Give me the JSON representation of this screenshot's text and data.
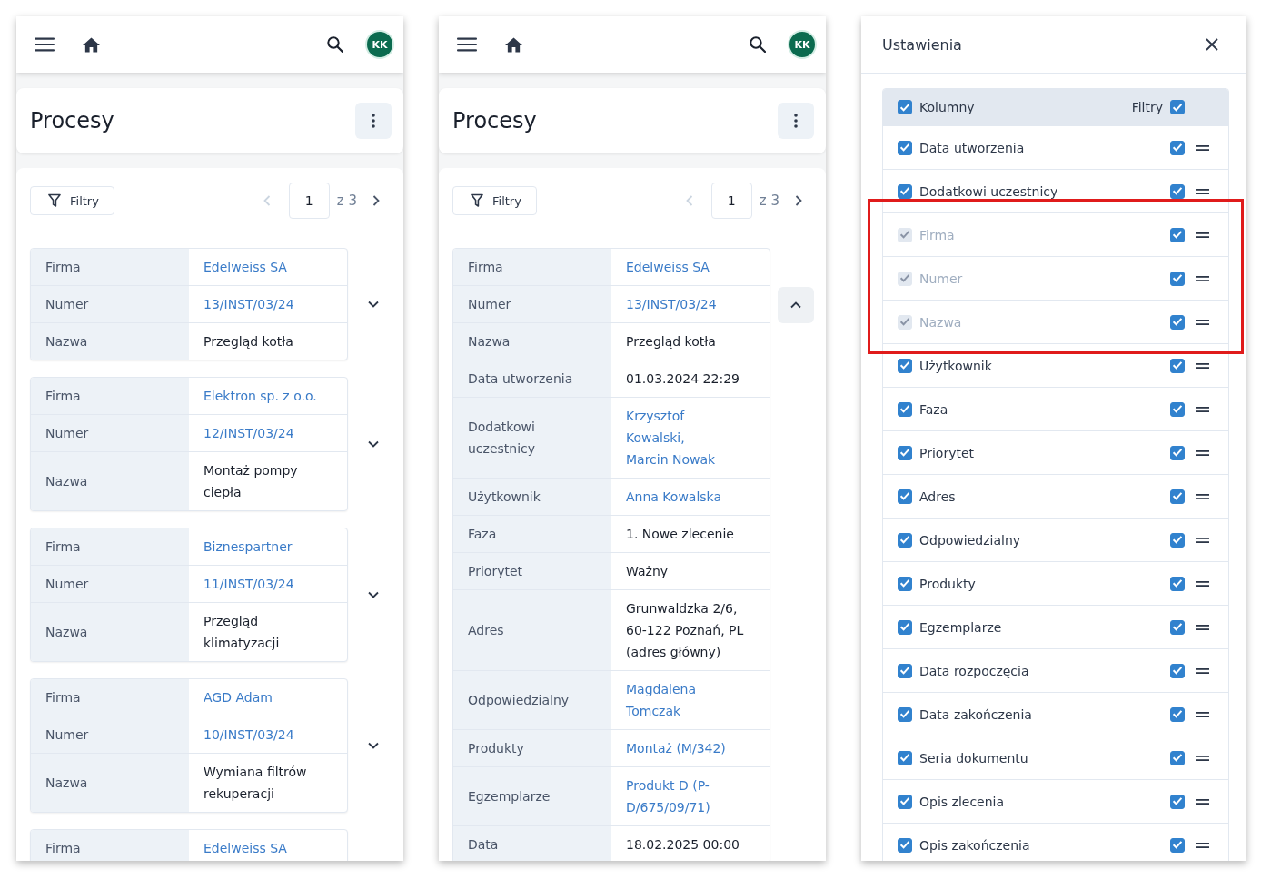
{
  "screens": [
    {
      "kind": "process_list",
      "top_bar": {
        "avatar": "KK"
      },
      "title": "Procesy",
      "toolbar": {
        "filter_button": "Filtry",
        "page": "1",
        "page_count": "z 3",
        "prev_disabled": true,
        "next_disabled": false
      },
      "records": [
        {
          "expanded": false,
          "toggle_visible": true,
          "fields": [
            {
              "label": "Firma",
              "value": "Edelweiss SA",
              "link": true
            },
            {
              "label": "Numer",
              "value": "13/INST/03/24",
              "link": true
            },
            {
              "label": "Nazwa",
              "value": "Przegląd kotła",
              "link": false
            }
          ]
        },
        {
          "expanded": false,
          "toggle_visible": true,
          "fields": [
            {
              "label": "Firma",
              "value": "Elektron sp. z o.o.",
              "link": true
            },
            {
              "label": "Numer",
              "value": "12/INST/03/24",
              "link": true
            },
            {
              "label": "Nazwa",
              "value": "Montaż pompy ciepła",
              "link": false
            }
          ]
        },
        {
          "expanded": false,
          "toggle_visible": true,
          "fields": [
            {
              "label": "Firma",
              "value": "Biznespartner",
              "link": true
            },
            {
              "label": "Numer",
              "value": "11/INST/03/24",
              "link": true
            },
            {
              "label": "Nazwa",
              "value": "Przegląd klimatyzacji",
              "link": false
            }
          ]
        },
        {
          "expanded": false,
          "toggle_visible": true,
          "fields": [
            {
              "label": "Firma",
              "value": "AGD Adam",
              "link": true
            },
            {
              "label": "Numer",
              "value": "10/INST/03/24",
              "link": true
            },
            {
              "label": "Nazwa",
              "value": "Wymiana filtrów rekuperacji",
              "link": false
            }
          ]
        },
        {
          "toggle_visible": false,
          "fields": [
            {
              "label": "Firma",
              "value": "Edelweiss SA",
              "link": true
            }
          ]
        }
      ]
    },
    {
      "kind": "process_list",
      "top_bar": {
        "avatar": "KK"
      },
      "title": "Procesy",
      "toolbar": {
        "filter_button": "Filtry",
        "page": "1",
        "page_count": "z 3",
        "prev_disabled": true,
        "next_disabled": false
      },
      "records": [
        {
          "expanded": true,
          "toggle_visible": true,
          "fields": [
            {
              "label": "Firma",
              "value": "Edelweiss SA",
              "link": true
            },
            {
              "label": "Numer",
              "value": "13/INST/03/24",
              "link": true
            },
            {
              "label": "Nazwa",
              "value": "Przegląd kotła",
              "link": false
            },
            {
              "label": "Data utworzenia",
              "value": "01.03.2024 22:29",
              "link": false
            },
            {
              "label": "Dodatkowi uczestnicy",
              "values": [
                "Krzysztof Kowalski,",
                "Marcin Nowak"
              ],
              "link": true
            },
            {
              "label": "Użytkownik",
              "value": "Anna Kowalska",
              "link": true
            },
            {
              "label": "Faza",
              "value": "1. Nowe zlecenie",
              "link": false
            },
            {
              "label": "Priorytet",
              "value": "Ważny",
              "link": false
            },
            {
              "label": "Adres",
              "value": "Grunwaldzka 2/6, 60-122 Poznań, PL (adres główny)",
              "link": false
            },
            {
              "label": "Odpowiedzialny",
              "value": "Magdalena Tomczak",
              "link": true
            },
            {
              "label": "Produkty",
              "value": "Montaż (M/342)",
              "link": true
            },
            {
              "label": "Egzemplarze",
              "value": "Produkt D (P-D/675/09/71)",
              "link": true
            },
            {
              "label": "Data",
              "value": "18.02.2025 00:00",
              "link": false
            }
          ]
        }
      ]
    },
    {
      "kind": "settings",
      "title": "Ustawienia",
      "columns_header": {
        "label": "Kolumny",
        "checked": true,
        "filter_label": "Filtry",
        "filter_checked": true
      },
      "columns": [
        {
          "label": "Data utworzenia",
          "checked": true,
          "disabled": false,
          "filter_checked": true,
          "highlighted": false
        },
        {
          "label": "Dodatkowi uczestnicy",
          "checked": true,
          "disabled": false,
          "filter_checked": true,
          "highlighted": false
        },
        {
          "label": "Firma",
          "checked": true,
          "disabled": true,
          "filter_checked": true,
          "highlighted": true
        },
        {
          "label": "Numer",
          "checked": true,
          "disabled": true,
          "filter_checked": true,
          "highlighted": true
        },
        {
          "label": "Nazwa",
          "checked": true,
          "disabled": true,
          "filter_checked": true,
          "highlighted": true
        },
        {
          "label": "Użytkownik",
          "checked": true,
          "disabled": false,
          "filter_checked": true,
          "highlighted": false
        },
        {
          "label": "Faza",
          "checked": true,
          "disabled": false,
          "filter_checked": true,
          "highlighted": false
        },
        {
          "label": "Priorytet",
          "checked": true,
          "disabled": false,
          "filter_checked": true,
          "highlighted": false
        },
        {
          "label": "Adres",
          "checked": true,
          "disabled": false,
          "filter_checked": true,
          "highlighted": false
        },
        {
          "label": "Odpowiedzialny",
          "checked": true,
          "disabled": false,
          "filter_checked": true,
          "highlighted": false
        },
        {
          "label": "Produkty",
          "checked": true,
          "disabled": false,
          "filter_checked": true,
          "highlighted": false
        },
        {
          "label": "Egzemplarze",
          "checked": true,
          "disabled": false,
          "filter_checked": true,
          "highlighted": false
        },
        {
          "label": "Data rozpoczęcia",
          "checked": true,
          "disabled": false,
          "filter_checked": true,
          "highlighted": false
        },
        {
          "label": "Data zakończenia",
          "checked": true,
          "disabled": false,
          "filter_checked": true,
          "highlighted": false
        },
        {
          "label": "Seria dokumentu",
          "checked": true,
          "disabled": false,
          "filter_checked": true,
          "highlighted": false
        },
        {
          "label": "Opis zlecenia",
          "checked": true,
          "disabled": false,
          "filter_checked": true,
          "highlighted": false
        },
        {
          "label": "Opis zakończenia",
          "checked": true,
          "disabled": false,
          "filter_checked": true,
          "highlighted": false
        }
      ]
    }
  ]
}
